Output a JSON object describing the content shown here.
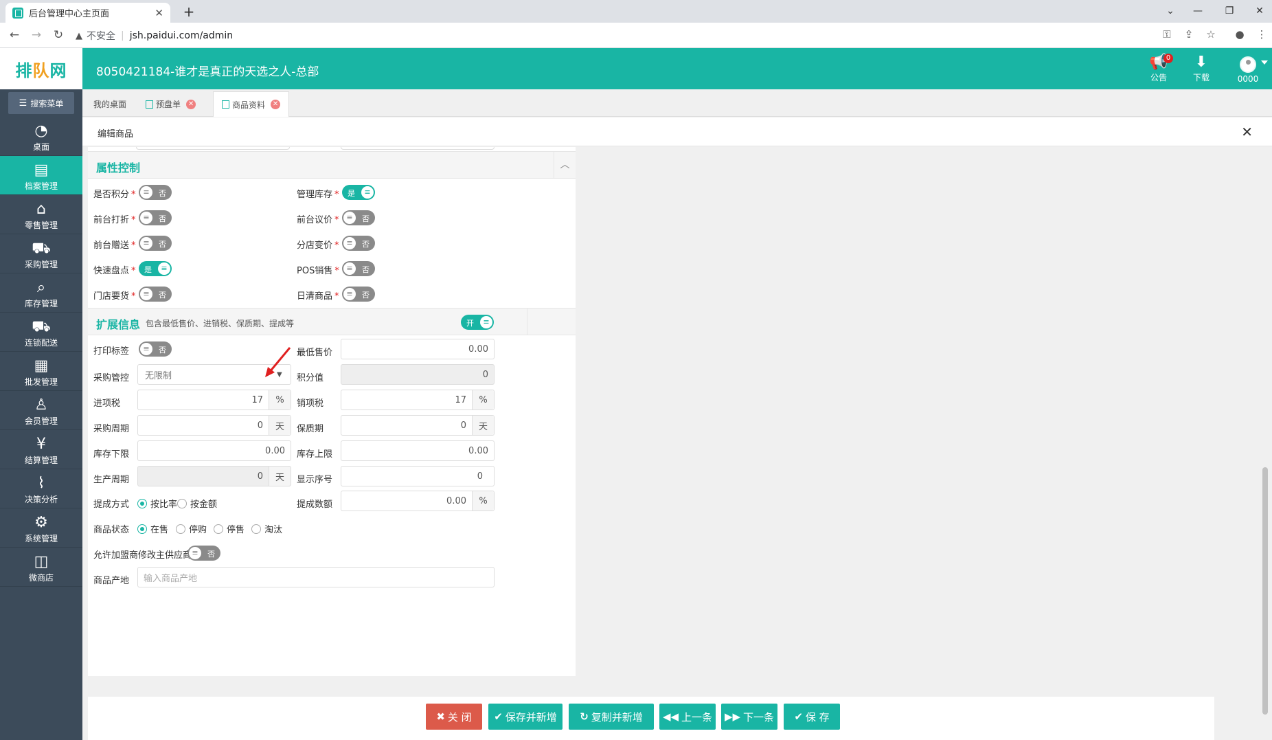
{
  "browser": {
    "tab_title": "后台管理中心主页面",
    "tab_close": "✕",
    "new_tab": "+",
    "security": "不安全",
    "url": "jsh.paidui.com/admin",
    "controls": {
      "minimize": "—",
      "restore": "❐",
      "close": "✕",
      "dropdown": "⌄"
    }
  },
  "app": {
    "logo_left": "排",
    "logo_mid": "队",
    "logo_right": "网",
    "title": "8050421184-谁才是真正的天选之人-总部",
    "notice_label": "公告",
    "notice_count": "0",
    "download_label": "下载",
    "user_label": "0000"
  },
  "sidebar": {
    "search_menu": "搜索菜单",
    "items": [
      {
        "label": "桌面",
        "icon": "dashboard-icon"
      },
      {
        "label": "档案管理",
        "icon": "file-icon",
        "active": true
      },
      {
        "label": "零售管理",
        "icon": "store-icon"
      },
      {
        "label": "采购管理",
        "icon": "cart-icon"
      },
      {
        "label": "库存管理",
        "icon": "inventory-icon"
      },
      {
        "label": "连锁配送",
        "icon": "truck-icon"
      },
      {
        "label": "批发管理",
        "icon": "wholesale-icon"
      },
      {
        "label": "会员管理",
        "icon": "member-icon"
      },
      {
        "label": "结算管理",
        "icon": "settlement-icon"
      },
      {
        "label": "决策分析",
        "icon": "chart-icon"
      },
      {
        "label": "系统管理",
        "icon": "gear-icon"
      },
      {
        "label": "微商店",
        "icon": "bag-icon"
      }
    ]
  },
  "page_tabs": [
    {
      "label": "我的桌面"
    },
    {
      "label": "预盘单"
    },
    {
      "label": "商品资料"
    }
  ],
  "edit_header": {
    "title": "编辑商品",
    "close": "✕"
  },
  "attr_section": {
    "title": "属性控制",
    "fields": [
      {
        "label": "是否积分",
        "state": "否"
      },
      {
        "label": "管理库存",
        "state": "是"
      },
      {
        "label": "前台打折",
        "state": "否"
      },
      {
        "label": "前台议价",
        "state": "否"
      },
      {
        "label": "前台赠送",
        "state": "否"
      },
      {
        "label": "分店变价",
        "state": "否"
      },
      {
        "label": "快速盘点",
        "state": "是"
      },
      {
        "label": "POS销售",
        "state": "否"
      },
      {
        "label": "门店要货",
        "state": "否"
      },
      {
        "label": "日清商品",
        "state": "否"
      }
    ],
    "required_mark": "*"
  },
  "ext_section": {
    "title": "扩展信息",
    "subtitle": "包含最低售价、进销税、保质期、提成等",
    "toggle": "开",
    "print_label": {
      "label": "打印标签",
      "state": "否"
    },
    "min_price": {
      "label": "最低售价",
      "value": "0.00"
    },
    "purchase_control": {
      "label": "采购管控",
      "value": "无限制"
    },
    "points": {
      "label": "积分值",
      "value": "0"
    },
    "input_tax": {
      "label": "进项税",
      "value": "17",
      "unit": "%"
    },
    "output_tax": {
      "label": "销项税",
      "value": "17",
      "unit": "%"
    },
    "purchase_cycle": {
      "label": "采购周期",
      "value": "0",
      "unit": "天"
    },
    "shelf_life": {
      "label": "保质期",
      "value": "0",
      "unit": "天"
    },
    "stock_min": {
      "label": "库存下限",
      "value": "0.00"
    },
    "stock_max": {
      "label": "库存上限",
      "value": "0.00"
    },
    "prod_cycle": {
      "label": "生产周期",
      "value": "0",
      "unit": "天"
    },
    "display_order": {
      "label": "显示序号",
      "value": "0"
    },
    "commission_method": {
      "label": "提成方式",
      "options": [
        "按比率",
        "按金额"
      ],
      "selected": "按比率"
    },
    "commission_value": {
      "label": "提成数额",
      "value": "0.00",
      "unit": "%"
    },
    "status": {
      "label": "商品状态",
      "options": [
        "在售",
        "停购",
        "停售",
        "淘汰"
      ],
      "selected": "在售"
    },
    "franchise_supplier": {
      "label": "允许加盟商修改主供应商",
      "state": "否"
    },
    "origin": {
      "label": "商品产地",
      "placeholder": "输入商品产地"
    }
  },
  "footer": {
    "close": "关 闭",
    "save_new": "保存并新增",
    "copy_new": "复制并新增",
    "prev": "上一条",
    "next": "下一条",
    "save": "保 存"
  },
  "colors": {
    "accent": "#19b5a4",
    "sidebar": "#3c4b5a",
    "danger": "#dc5a4a"
  }
}
